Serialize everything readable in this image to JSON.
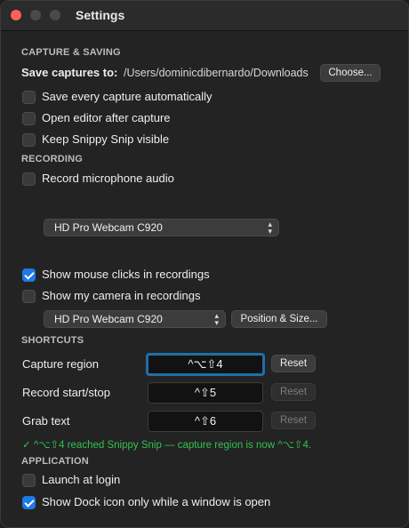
{
  "window": {
    "title": "Settings"
  },
  "capture": {
    "section_title": "CAPTURE & SAVING",
    "save_label": "Save captures to:",
    "save_path": "/Users/dominicdibernardo/Downloads",
    "choose_label": "Choose...",
    "options": [
      {
        "label": "Save every capture automatically",
        "checked": false
      },
      {
        "label": "Open editor after capture",
        "checked": false
      },
      {
        "label": "Keep Snippy Snip visible",
        "checked": false
      }
    ]
  },
  "recording": {
    "section_title": "RECORDING",
    "mic_label": "Record microphone audio",
    "mic_checked": false,
    "mic_device": "HD Pro Webcam C920",
    "clicks_label": "Show mouse clicks in recordings",
    "clicks_checked": true,
    "camera_label": "Show my camera in recordings",
    "camera_checked": false,
    "camera_device": "HD Pro Webcam C920",
    "position_label": "Position & Size..."
  },
  "shortcuts": {
    "section_title": "SHORTCUTS",
    "rows": [
      {
        "label": "Capture region",
        "keys": "^⌥⇧4",
        "reset": "Reset"
      },
      {
        "label": "Record start/stop",
        "keys": "^⇧5",
        "reset": "Reset"
      },
      {
        "label": "Grab text",
        "keys": "^⇧6",
        "reset": "Reset"
      }
    ],
    "status": "✓ ^⌥⇧4 reached Snippy Snip — capture region is now ^⌥⇧4."
  },
  "application": {
    "section_title": "APPLICATION",
    "login_label": "Launch at login",
    "login_checked": false,
    "dock_label": "Show Dock icon only while a window is open",
    "dock_checked": true
  }
}
